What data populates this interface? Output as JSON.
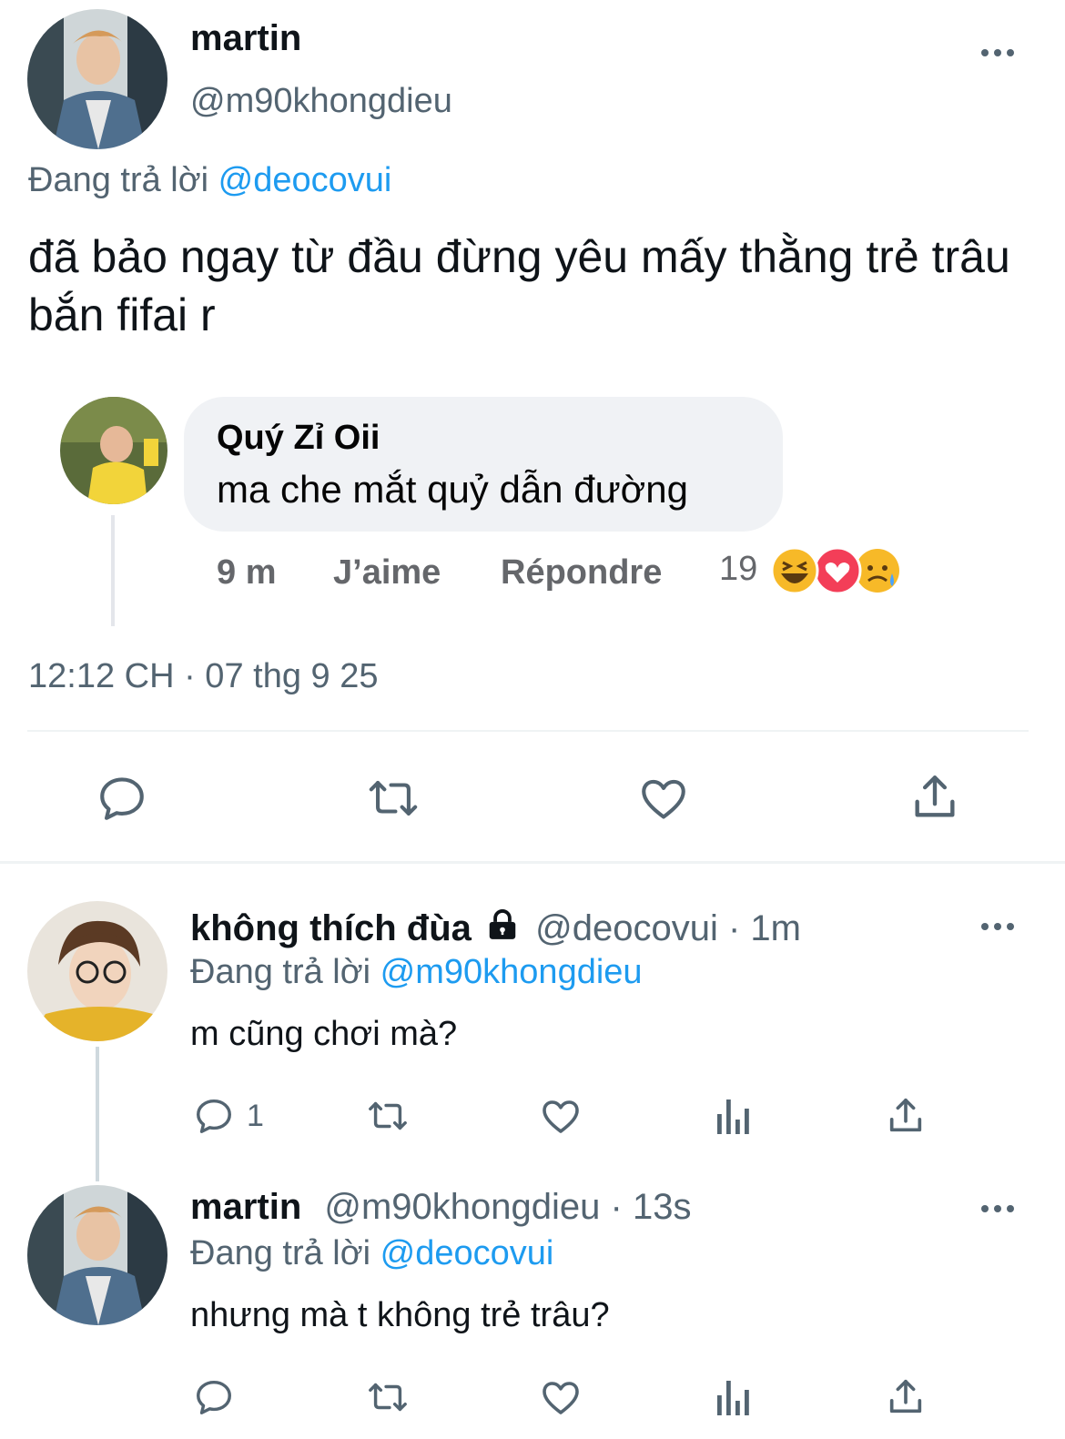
{
  "main_tweet": {
    "display_name": "martin",
    "handle": "@m90khongdieu",
    "reply_prefix": "Đang trả lời",
    "reply_to": "@deocovui",
    "text": "đã bảo ngay từ đầu đừng yêu mấy thằng trẻ trâu bắn fifai r",
    "timestamp": "12:12 CH · 07 thg 9 25"
  },
  "embedded_comment": {
    "author": "Quý Zỉ Oii",
    "text": "ma che mắt quỷ dẫn đường",
    "time": "9 m",
    "like_label": "J’aime",
    "reply_label": "Répondre",
    "reaction_count": "19"
  },
  "replies": [
    {
      "display_name": "không thích đùa",
      "handle_meta": "@deocovui · 1m",
      "reply_prefix": "Đang trả lời",
      "reply_to": "@m90khongdieu",
      "text": "m cũng chơi mà?",
      "reply_count": "1"
    },
    {
      "display_name": "martin",
      "handle_meta": "@m90khongdieu · 13s",
      "reply_prefix": "Đang trả lời",
      "reply_to": "@deocovui",
      "text": "nhưng mà t không trẻ trâu?",
      "reply_count": ""
    }
  ],
  "colors": {
    "link": "#1d9bf0",
    "muted": "#536471",
    "divider": "#eff3f4",
    "bubble": "#f0f2f5"
  },
  "icons": [
    "more-icon",
    "reply-icon",
    "retweet-icon",
    "like-icon",
    "share-icon",
    "views-icon",
    "lock-icon",
    "haha-emoji-icon",
    "love-emoji-icon",
    "sad-emoji-icon"
  ]
}
